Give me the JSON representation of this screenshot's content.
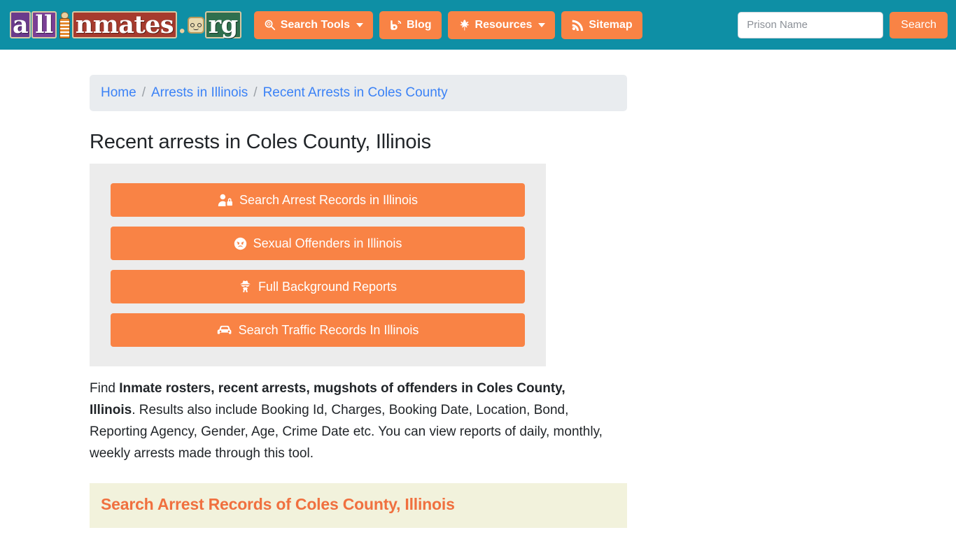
{
  "colors": {
    "header_teal": "#0e8fa5",
    "accent_orange": "#f98345",
    "breadcrumb_bg": "#e9ecef",
    "panel_grey": "#ececec",
    "panel_cream": "#f2f2dc",
    "link_blue": "#3b82f6"
  },
  "header": {
    "logo": {
      "part_a": "a",
      "part_ll": "ll",
      "figure_icon": "inmate-figure-icon",
      "part_nmates": "nmates",
      "dot": ".",
      "face_icon": "prisoner-face-icon",
      "part_rg": "rg",
      "alt": "allinmates.org"
    },
    "nav": [
      {
        "label": "Search Tools",
        "icon": "search-icon",
        "has_caret": true
      },
      {
        "label": "Blog",
        "icon": "blog-icon",
        "has_caret": false
      },
      {
        "label": "Resources",
        "icon": "leaf-icon",
        "has_caret": true
      },
      {
        "label": "Sitemap",
        "icon": "rss-icon",
        "has_caret": false
      }
    ],
    "search": {
      "placeholder": "Prison Name",
      "value": "",
      "button_label": "Search"
    }
  },
  "breadcrumb": {
    "items": [
      {
        "label": "Home"
      },
      {
        "label": "Arrests in Illinois"
      },
      {
        "label": "Recent Arrests in Coles County"
      }
    ],
    "separator": "/"
  },
  "main": {
    "page_title": "Recent arrests in Coles County, Illinois",
    "action_buttons": [
      {
        "label": "Search Arrest Records in Illinois",
        "icon": "user-lock-icon"
      },
      {
        "label": "Sexual Offenders in Illinois",
        "icon": "angry-face-icon"
      },
      {
        "label": "Full Background Reports",
        "icon": "user-secret-icon"
      },
      {
        "label": "Search Traffic Records In Illinois",
        "icon": "car-icon"
      }
    ],
    "paragraph": {
      "lead": "Find ",
      "bold": "Inmate rosters, recent arrests, mugshots of offenders in Coles County, Illinois",
      "rest": ". Results also include Booking Id, Charges, Booking Date, Location, Bond, Reporting Agency, Gender, Age, Crime Date etc. You can view reports of daily, monthly, weekly arrests made through this tool."
    },
    "section_heading": "Search Arrest Records of Coles County, Illinois"
  }
}
